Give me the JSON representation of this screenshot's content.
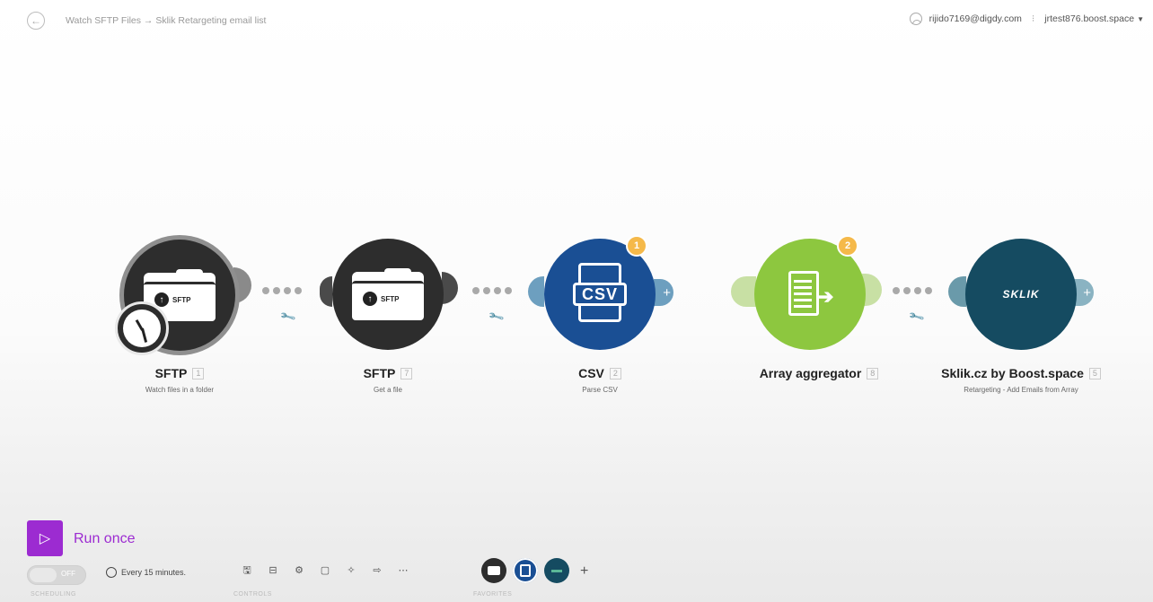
{
  "header": {
    "breadcrumb": "Watch SFTP Files → Sklik Retargeting email list",
    "user_email": "rijido7169@digdy.com",
    "workspace": "jrtest876.boost.space"
  },
  "modules": [
    {
      "name": "SFTP",
      "number": "1",
      "description": "Watch files in a folder",
      "color": "#2d2d2d",
      "icon": "sftp-folder-icon"
    },
    {
      "name": "SFTP",
      "number": "7",
      "description": "Get a file",
      "color": "#2d2d2d",
      "icon": "sftp-folder-icon"
    },
    {
      "name": "CSV",
      "number": "2",
      "description": "Parse CSV",
      "color": "#1a4f94",
      "icon": "csv-document-icon",
      "badge": "1"
    },
    {
      "name": "Array aggregator",
      "number": "8",
      "description": "",
      "color": "#8dc73f",
      "icon": "array-aggregator-icon",
      "badge": "2"
    },
    {
      "name": "Sklik.cz by Boost.space",
      "number": "5",
      "description": "Retargeting - Add Emails from Array",
      "color": "#154b61",
      "icon": "sklik-logo-icon"
    }
  ],
  "icons": {
    "sftp_label": "SFTP",
    "csv_label": "CSV",
    "sklik_logo": "SKLIK"
  },
  "bottom": {
    "run_label": "Run once",
    "toggle_label": "OFF",
    "schedule": "Every 15 minutes.",
    "sections": [
      "SCHEDULING",
      "CONTROLS",
      "FAVORITES"
    ]
  },
  "colors": {
    "accent": "#9c2bd1",
    "badge": "#f5b94a"
  }
}
